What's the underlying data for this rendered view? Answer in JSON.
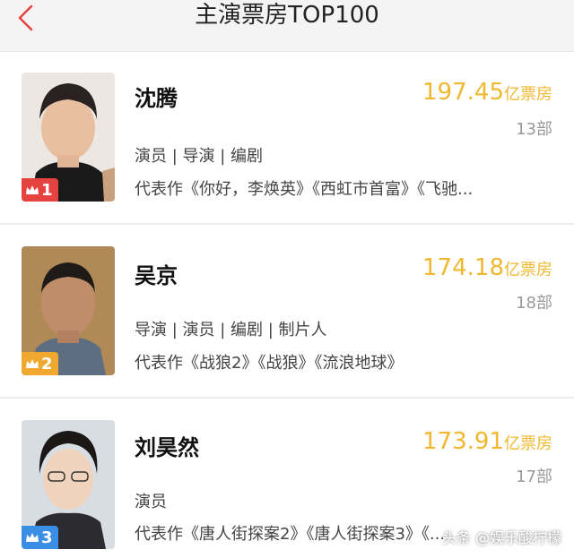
{
  "header": {
    "title": "主演票房TOP100",
    "back_icon": "chevron-left-icon",
    "accent": "#e64340"
  },
  "actors": [
    {
      "name": "沈腾",
      "rank": "1",
      "rank_color": "#e64340",
      "box_office": "197.45",
      "box_office_unit": "亿票房",
      "film_count": "13部",
      "roles": "演员 | 导演 | 编剧",
      "works": "代表作《你好，李焕英》《西虹市首富》《飞驰..."
    },
    {
      "name": "吴京",
      "rank": "2",
      "rank_color": "#f0a830",
      "box_office": "174.18",
      "box_office_unit": "亿票房",
      "film_count": "18部",
      "roles": "导演 | 演员 | 编剧 | 制片人",
      "works": "代表作《战狼2》《战狼》《流浪地球》"
    },
    {
      "name": "刘昊然",
      "rank": "3",
      "rank_color": "#3a8ee6",
      "box_office": "173.91",
      "box_office_unit": "亿票房",
      "film_count": "17部",
      "roles": "演员",
      "works": "代表作《唐人街探案2》《唐人街探案3》《..."
    }
  ],
  "watermark": "头条 @娱乐酸柠檬",
  "colors": {
    "box_office": "#f0b830",
    "muted": "#999999"
  }
}
